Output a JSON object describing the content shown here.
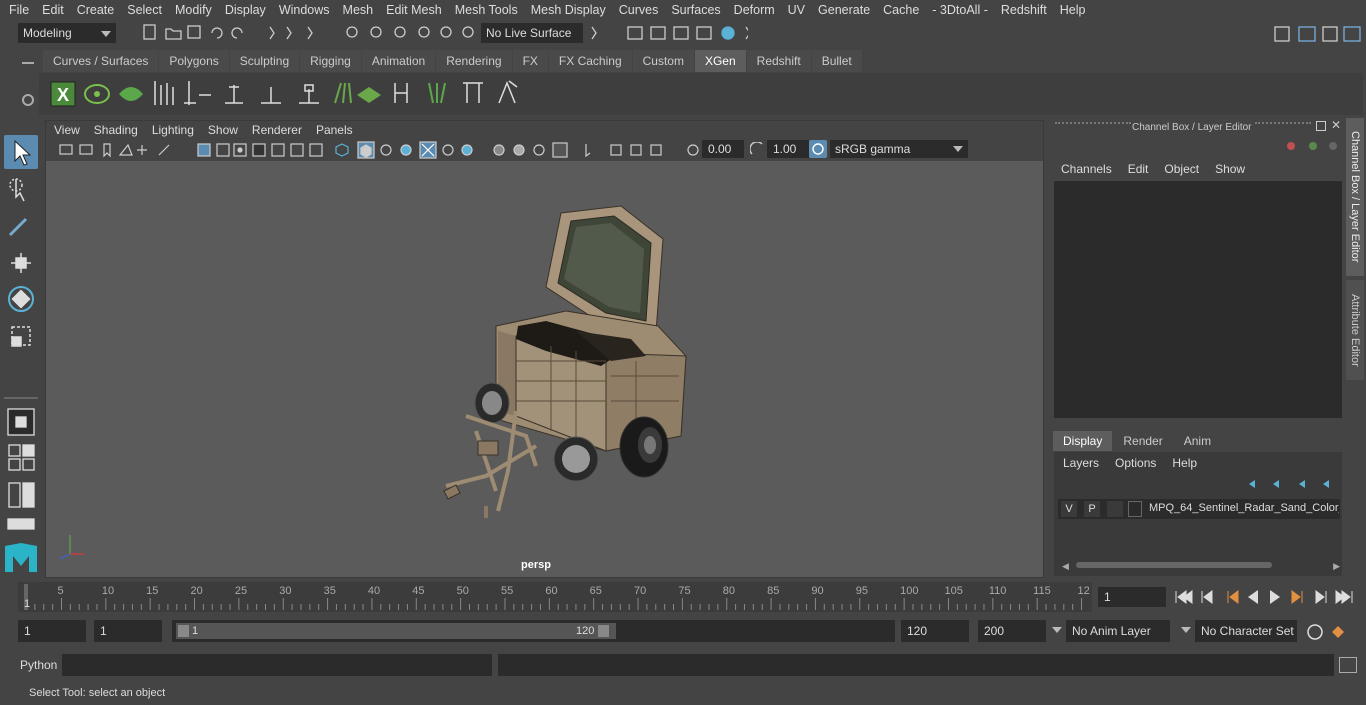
{
  "menu": [
    "File",
    "Edit",
    "Create",
    "Select",
    "Modify",
    "Display",
    "Windows",
    "Mesh",
    "Edit Mesh",
    "Mesh Tools",
    "Mesh Display",
    "Curves",
    "Surfaces",
    "Deform",
    "UV",
    "Generate",
    "Cache",
    "- 3DtoAll -",
    "Redshift",
    "Help"
  ],
  "status": {
    "mode": "Modeling",
    "live_surface": "No Live Surface"
  },
  "shelf_tabs": [
    "Curves / Surfaces",
    "Polygons",
    "Sculpting",
    "Rigging",
    "Animation",
    "Rendering",
    "FX",
    "FX Caching",
    "Custom",
    "XGen",
    "Redshift",
    "Bullet"
  ],
  "shelf_active": "XGen",
  "viewport": {
    "menu": [
      "View",
      "Shading",
      "Lighting",
      "Show",
      "Renderer",
      "Panels"
    ],
    "exposure": "0.00",
    "gamma": "1.00",
    "color_space": "sRGB gamma",
    "camera_label": "persp"
  },
  "channel_box": {
    "title": "Channel Box / Layer Editor",
    "menu": [
      "Channels",
      "Edit",
      "Object",
      "Show"
    ],
    "layer_tabs": [
      "Display",
      "Render",
      "Anim"
    ],
    "layer_menu": [
      "Layers",
      "Options",
      "Help"
    ],
    "layer": {
      "v": "V",
      "p": "P",
      "name": "MPQ_64_Sentinel_Radar_Sand_Color_"
    }
  },
  "side_tabs": [
    "Channel Box / Layer Editor",
    "Attribute Editor"
  ],
  "timeline": {
    "ticks": [
      "5",
      "10",
      "15",
      "20",
      "25",
      "30",
      "35",
      "40",
      "45",
      "50",
      "55",
      "60",
      "65",
      "70",
      "75",
      "80",
      "85",
      "90",
      "95",
      "100",
      "105",
      "110",
      "115",
      "12"
    ],
    "start_label": "1",
    "current_frame": "1"
  },
  "range": {
    "start": "1",
    "start2": "1",
    "slider_start": "1",
    "slider_end": "120",
    "end": "120",
    "end2": "200",
    "anim_layer": "No Anim Layer",
    "char_set": "No Character Set"
  },
  "cmd": {
    "label": "Python"
  },
  "help": {
    "text": "Select Tool: select an object"
  },
  "colors": {
    "accent": "#5285a6",
    "bg": "#444444",
    "viewport": "#5b5b5b",
    "field": "#2b2b2b"
  }
}
